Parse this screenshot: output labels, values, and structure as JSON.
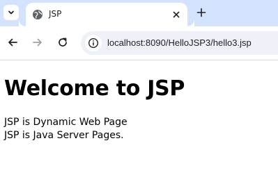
{
  "browser": {
    "tab": {
      "title": "JSP",
      "icon": "globe-icon"
    },
    "address_bar": {
      "url": "localhost:8090/HelloJSP3/hello3.jsp",
      "icon": "site-info-icon"
    },
    "colors": {
      "tabstrip": "#d3e3fd",
      "omnibox": "#eef1f8"
    }
  },
  "page": {
    "heading": "Welcome to JSP",
    "lines": [
      "JSP is Dynamic Web Page",
      "JSP is Java Server Pages."
    ]
  }
}
